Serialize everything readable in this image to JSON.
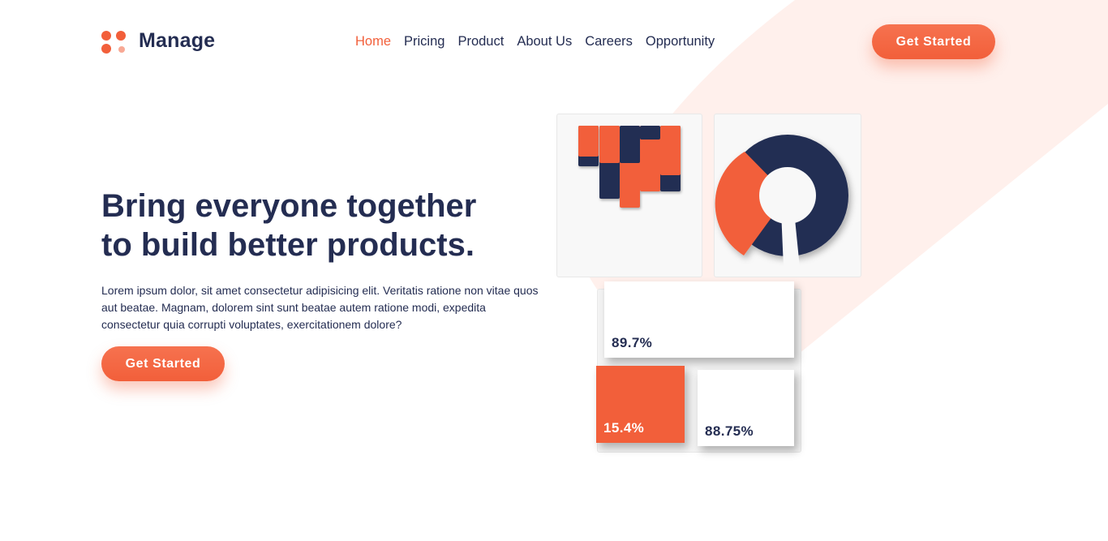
{
  "brand": {
    "name": "Manage"
  },
  "nav": {
    "items": [
      {
        "label": "Home",
        "active": true
      },
      {
        "label": "Pricing",
        "active": false
      },
      {
        "label": "Product",
        "active": false
      },
      {
        "label": "About Us",
        "active": false
      },
      {
        "label": "Careers",
        "active": false
      },
      {
        "label": "Opportunity",
        "active": false
      }
    ],
    "cta_label": "Get Started"
  },
  "hero": {
    "title_line1": "Bring everyone together",
    "title_line2": "to build better products.",
    "body": "Lorem ipsum dolor, sit amet consectetur adipisicing elit. Veritatis ratione non vitae quos aut beatae. Magnam, dolorem sint sunt beatae autem ratione modi, expedita consectetur quia corrupti voluptates, exercitationem dolore?",
    "cta_label": "Get Started"
  },
  "illustration": {
    "stats": {
      "top": "89.7%",
      "bottom_left": "15.4%",
      "bottom_right": "88.75%"
    }
  },
  "colors": {
    "accent": "#f25f3a",
    "accent_light": "#f8a995",
    "navy": "#242d52",
    "background_shape": "#fff0ec"
  }
}
